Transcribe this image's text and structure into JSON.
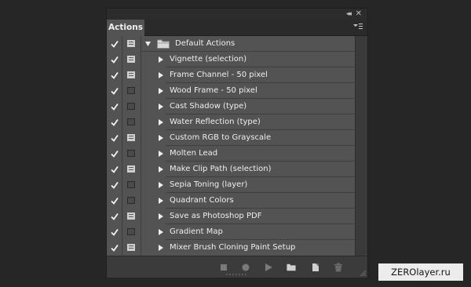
{
  "panel": {
    "tab_label": "Actions",
    "controls": {
      "collapse": "◂◂",
      "close": "✕"
    }
  },
  "action_set": {
    "name": "Default Actions",
    "expanded": true,
    "checked": true,
    "dialog_toggle": true,
    "icon": "folder-icon"
  },
  "actions": [
    {
      "label": "Vignette (selection)",
      "checked": true,
      "dialog": true
    },
    {
      "label": "Frame Channel - 50 pixel",
      "checked": true,
      "dialog": true
    },
    {
      "label": "Wood Frame - 50 pixel",
      "checked": true,
      "dialog": false
    },
    {
      "label": "Cast Shadow (type)",
      "checked": true,
      "dialog": false
    },
    {
      "label": "Water Reflection (type)",
      "checked": true,
      "dialog": false
    },
    {
      "label": "Custom RGB to Grayscale",
      "checked": true,
      "dialog": true
    },
    {
      "label": "Molten Lead",
      "checked": true,
      "dialog": false
    },
    {
      "label": "Make Clip Path (selection)",
      "checked": true,
      "dialog": true
    },
    {
      "label": "Sepia Toning (layer)",
      "checked": true,
      "dialog": false
    },
    {
      "label": "Quadrant Colors",
      "checked": true,
      "dialog": false
    },
    {
      "label": "Save as Photoshop PDF",
      "checked": true,
      "dialog": true
    },
    {
      "label": "Gradient Map",
      "checked": true,
      "dialog": false
    },
    {
      "label": "Mixer Brush Cloning Paint Setup",
      "checked": true,
      "dialog": true
    }
  ],
  "toolbar": [
    "stop-icon",
    "record-icon",
    "play-icon",
    "new-set-icon",
    "new-action-icon",
    "delete-icon"
  ],
  "watermark": "ZEROlayer.ru"
}
